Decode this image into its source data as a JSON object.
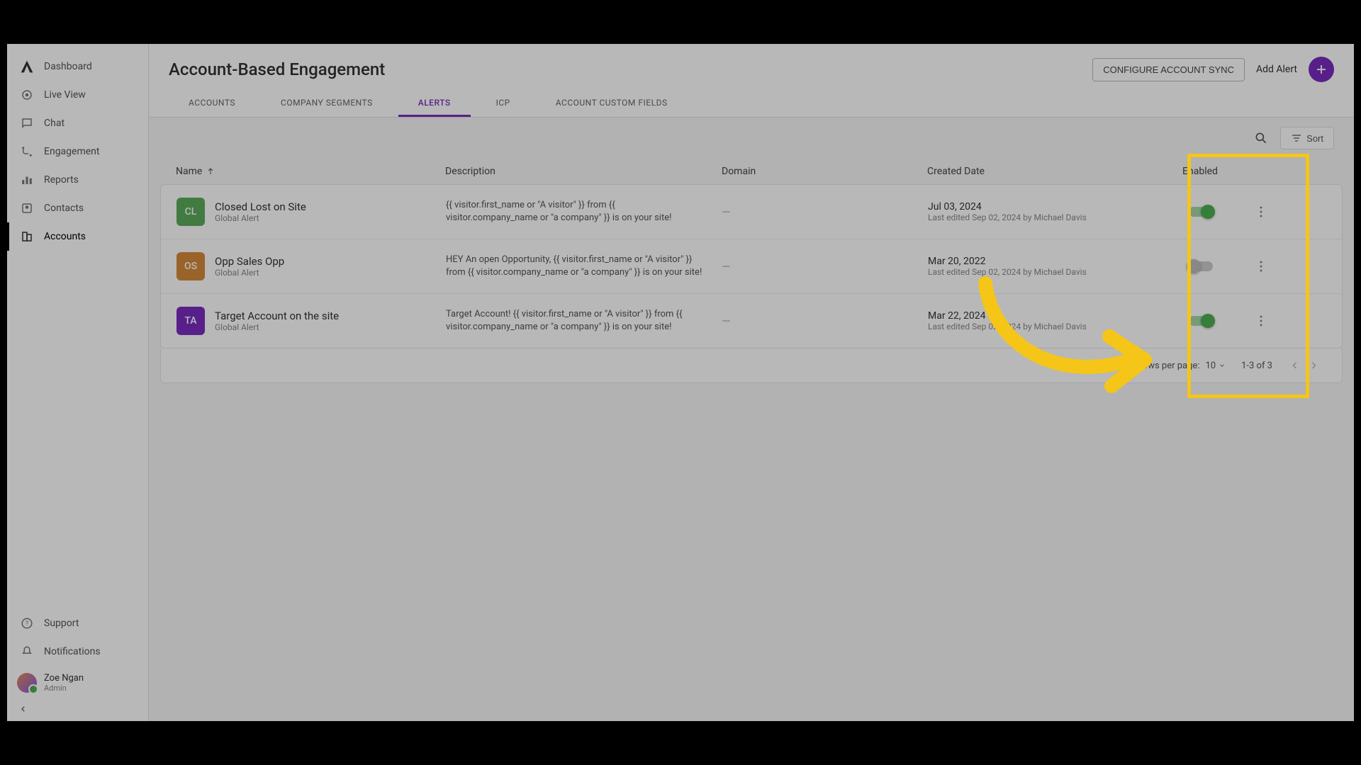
{
  "sidebar": {
    "items": [
      {
        "label": "Dashboard",
        "name": "sidebar-item-dashboard"
      },
      {
        "label": "Live View",
        "name": "sidebar-item-live-view"
      },
      {
        "label": "Chat",
        "name": "sidebar-item-chat"
      },
      {
        "label": "Engagement",
        "name": "sidebar-item-engagement"
      },
      {
        "label": "Reports",
        "name": "sidebar-item-reports"
      },
      {
        "label": "Contacts",
        "name": "sidebar-item-contacts"
      },
      {
        "label": "Accounts",
        "name": "sidebar-item-accounts"
      }
    ],
    "support": "Support",
    "notifications": "Notifications",
    "user_name": "Zoe Ngan",
    "user_role": "Admin"
  },
  "header": {
    "title": "Account-Based Engagement",
    "configure_btn": "CONFIGURE ACCOUNT SYNC",
    "add_alert_label": "Add Alert",
    "tabs": [
      {
        "label": "ACCOUNTS"
      },
      {
        "label": "COMPANY SEGMENTS"
      },
      {
        "label": "ALERTS"
      },
      {
        "label": "ICP"
      },
      {
        "label": "ACCOUNT CUSTOM FIELDS"
      }
    ],
    "active_tab_index": 2
  },
  "toolbar": {
    "sort_label": "Sort"
  },
  "columns": {
    "name": "Name",
    "description": "Description",
    "domain": "Domain",
    "created": "Created Date",
    "enabled": "Enabled"
  },
  "rows": [
    {
      "badge": "CL",
      "badge_color": "#5cab5c",
      "name": "Closed Lost on Site",
      "subtitle": "Global Alert",
      "description": "{{ visitor.first_name or \"A visitor\" }} from {{ visitor.company_name or \"a company\" }} is on your site!",
      "domain": "---",
      "created": "Jul 03, 2024",
      "edited": "Last edited Sep 02, 2024 by Michael Davis",
      "enabled": true
    },
    {
      "badge": "OS",
      "badge_color": "#d68a3a",
      "name": "Opp Sales Opp",
      "subtitle": "Global Alert",
      "description": "HEY An open Opportunity, {{ visitor.first_name or \"A visitor\" }} from {{ visitor.company_name or \"a company\" }} is on your site!",
      "domain": "---",
      "created": "Mar 20, 2022",
      "edited": "Last edited Sep 02, 2024 by Michael Davis",
      "enabled": false
    },
    {
      "badge": "TA",
      "badge_color": "#7b2cbf",
      "name": "Target Account on the site",
      "subtitle": "Global Alert",
      "description": "Target Account! {{ visitor.first_name or \"A visitor\" }} from {{ visitor.company_name or \"a company\" }} is on your site!",
      "domain": "---",
      "created": "Mar 22, 2024",
      "edited": "Last edited Sep 02, 2024 by Michael Davis",
      "enabled": true
    }
  ],
  "pager": {
    "rows_per_page_label": "Rows per page:",
    "rows_per_page_value": "10",
    "range": "1-3 of 3"
  }
}
